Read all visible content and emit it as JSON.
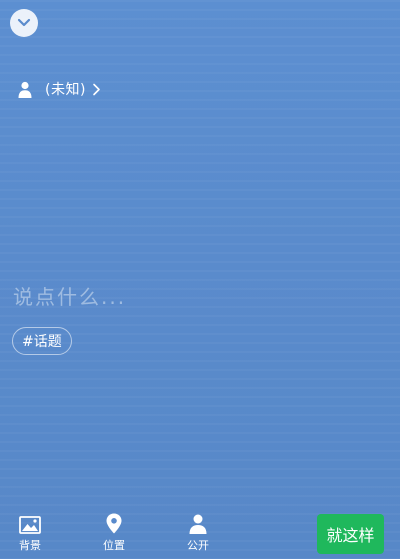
{
  "header": {
    "collapse_icon": "chevron-down-icon"
  },
  "author": {
    "icon": "person-icon",
    "label": "(未知)"
  },
  "compose": {
    "placeholder": "说点什么..."
  },
  "topic": {
    "label": "#话题"
  },
  "toolbar": {
    "items": [
      {
        "icon": "image-icon",
        "label": "背景"
      },
      {
        "icon": "location-pin-icon",
        "label": "位置"
      },
      {
        "icon": "person-icon",
        "label": "公开"
      }
    ],
    "submit_label": "就这样"
  },
  "colors": {
    "background": "#5a8bcc",
    "submit": "#1fb85c",
    "text": "#ffffff"
  }
}
